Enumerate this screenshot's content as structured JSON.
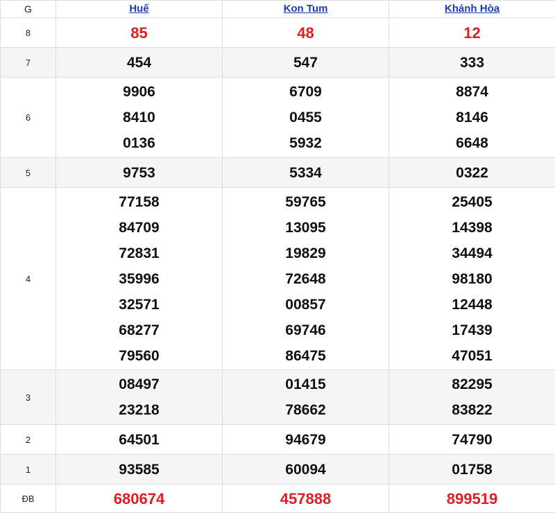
{
  "header": {
    "grade_label": "G",
    "provinces": [
      "Huế",
      "Kon Tum",
      "Khánh Hòa"
    ]
  },
  "rows": [
    {
      "grade": "8",
      "values": [
        [
          "85"
        ],
        [
          "48"
        ],
        [
          "12"
        ]
      ]
    },
    {
      "grade": "7",
      "values": [
        [
          "454"
        ],
        [
          "547"
        ],
        [
          "333"
        ]
      ]
    },
    {
      "grade": "6",
      "values": [
        [
          "9906",
          "8410",
          "0136"
        ],
        [
          "6709",
          "0455",
          "5932"
        ],
        [
          "8874",
          "8146",
          "6648"
        ]
      ]
    },
    {
      "grade": "5",
      "values": [
        [
          "9753"
        ],
        [
          "5334"
        ],
        [
          "0322"
        ]
      ]
    },
    {
      "grade": "4",
      "values": [
        [
          "77158",
          "84709",
          "72831",
          "35996",
          "32571",
          "68277",
          "79560"
        ],
        [
          "59765",
          "13095",
          "19829",
          "72648",
          "00857",
          "69746",
          "86475"
        ],
        [
          "25405",
          "14398",
          "34494",
          "98180",
          "12448",
          "17439",
          "47051"
        ]
      ]
    },
    {
      "grade": "3",
      "values": [
        [
          "08497",
          "23218"
        ],
        [
          "01415",
          "78662"
        ],
        [
          "82295",
          "83822"
        ]
      ]
    },
    {
      "grade": "2",
      "values": [
        [
          "64501"
        ],
        [
          "94679"
        ],
        [
          "74790"
        ]
      ]
    },
    {
      "grade": "1",
      "values": [
        [
          "93585"
        ],
        [
          "60094"
        ],
        [
          "01758"
        ]
      ]
    },
    {
      "grade": "ĐB",
      "values": [
        [
          "680674"
        ],
        [
          "457888"
        ],
        [
          "899519"
        ]
      ]
    }
  ],
  "colors": {
    "highlight": "#e21c24",
    "link": "#1a3bb3",
    "alt_row": "#f5f5f5"
  }
}
